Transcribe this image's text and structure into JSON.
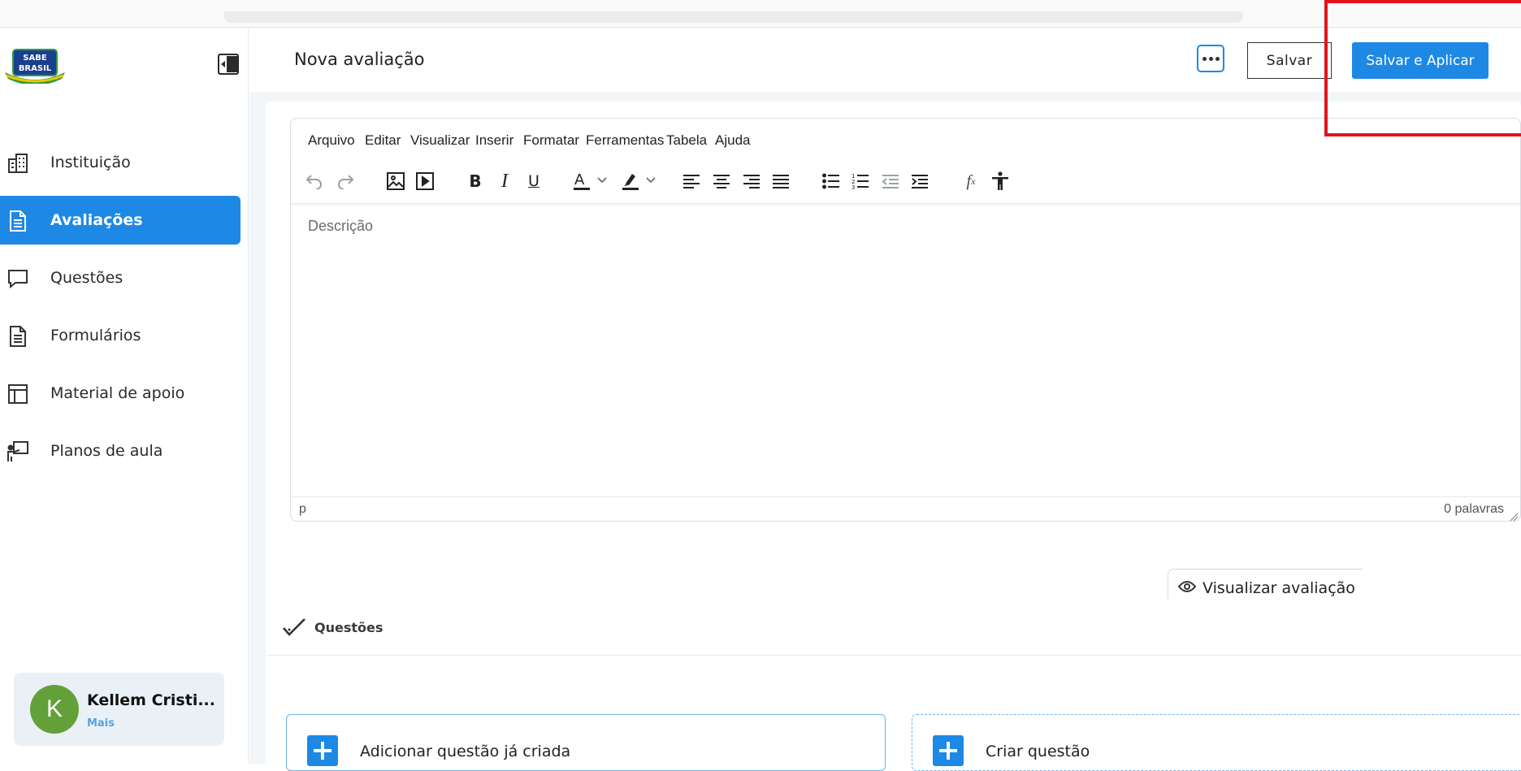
{
  "app": {
    "logo_text_line1": "SABE",
    "logo_text_line2": "BRASIL"
  },
  "sidebar": {
    "items": [
      {
        "label": "Instituição",
        "icon": "building-icon",
        "active": false
      },
      {
        "label": "Avaliações",
        "icon": "document-icon",
        "active": true
      },
      {
        "label": "Questões",
        "icon": "chat-bubble-icon",
        "active": false
      },
      {
        "label": "Formulários",
        "icon": "form-icon",
        "active": false
      },
      {
        "label": "Material de apoio",
        "icon": "layout-icon",
        "active": false
      },
      {
        "label": "Planos de aula",
        "icon": "teacher-board-icon",
        "active": false
      }
    ],
    "user": {
      "initial": "K",
      "name": "Kellem Cristi...",
      "more_label": "Mais"
    }
  },
  "header": {
    "title": "Nova avaliação",
    "save_label": "Salvar",
    "save_apply_label": "Salvar e Aplicar"
  },
  "editor": {
    "menu": [
      "Arquivo",
      "Editar",
      "Visualizar",
      "Inserir",
      "Formatar",
      "Ferramentas",
      "Tabela",
      "Ajuda"
    ],
    "toolbar_icons": [
      "undo-icon",
      "redo-icon",
      "image-icon",
      "media-icon",
      "bold-icon",
      "italic-icon",
      "underline-icon",
      "text-color-icon",
      "highlight-icon",
      "align-left-icon",
      "align-center-icon",
      "align-right-icon",
      "justify-icon",
      "bullet-list-icon",
      "numbered-list-icon",
      "outdent-icon",
      "indent-icon",
      "formula-icon",
      "accessibility-icon"
    ],
    "placeholder": "Descrição",
    "status_path": "p",
    "word_count": "0 palavras"
  },
  "preview_button": "Visualizar avaliação",
  "questions": {
    "title": "Questões",
    "add_existing_label": "Adicionar questão já criada",
    "create_label": "Criar questão"
  },
  "colors": {
    "accent": "#1e88e5",
    "highlight_box": "#e0141c",
    "avatar": "#64a03a"
  }
}
